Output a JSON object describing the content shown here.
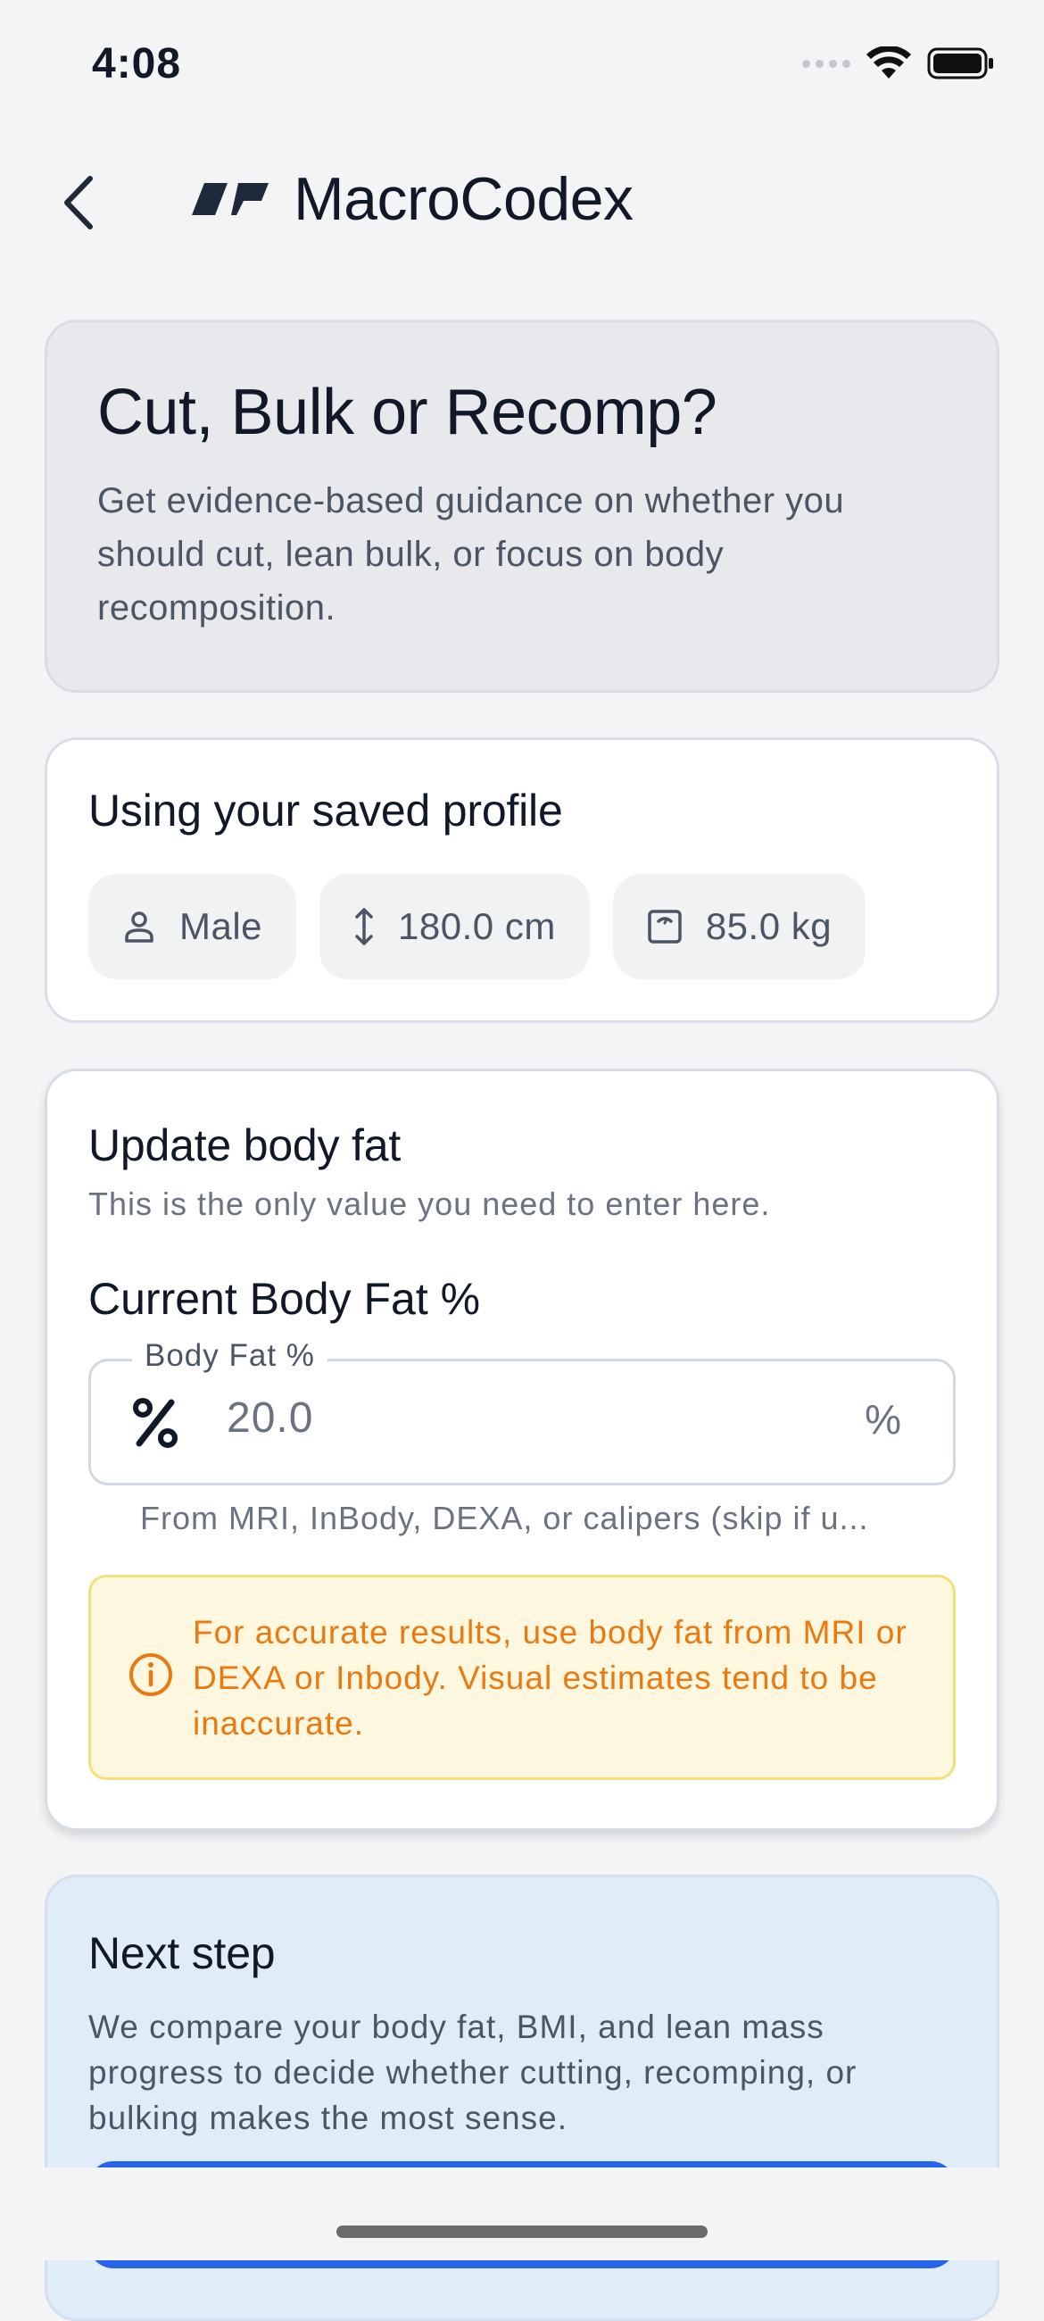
{
  "status_bar": {
    "time": "4:08"
  },
  "nav": {
    "brand_title": "MacroCodex"
  },
  "hero": {
    "title": "Cut, Bulk or Recomp?",
    "description": "Get evidence-based guidance on whether you should cut, lean bulk, or focus on body recomposition."
  },
  "profile": {
    "title": "Using your saved profile",
    "chips": [
      {
        "icon": "person-icon",
        "label": "Male"
      },
      {
        "icon": "height-icon",
        "label": "180.0 cm"
      },
      {
        "icon": "scale-icon",
        "label": "85.0 kg"
      }
    ]
  },
  "body_fat": {
    "title": "Update body fat",
    "subtitle": "This is the only value you need to enter here.",
    "field_label": "Current Body Fat %",
    "input_legend": "Body Fat %",
    "input_value": "20.0",
    "input_suffix": "%",
    "helper": "From MRI, InBody, DEXA, or calipers (skip if u...",
    "warning": "For accurate results, use body fat from MRI or DEXA or Inbody. Visual estimates tend to be inaccurate."
  },
  "next_step": {
    "title": "Next step",
    "description": "We compare your body fat, BMI, and lean mass progress to decide whether cutting, recomping, or bulking makes the most sense."
  },
  "colors": {
    "accent": "#2563eb",
    "warning_text": "#ea7a10",
    "warning_bg": "#fdf7df",
    "info_bg": "#e0edf9"
  }
}
